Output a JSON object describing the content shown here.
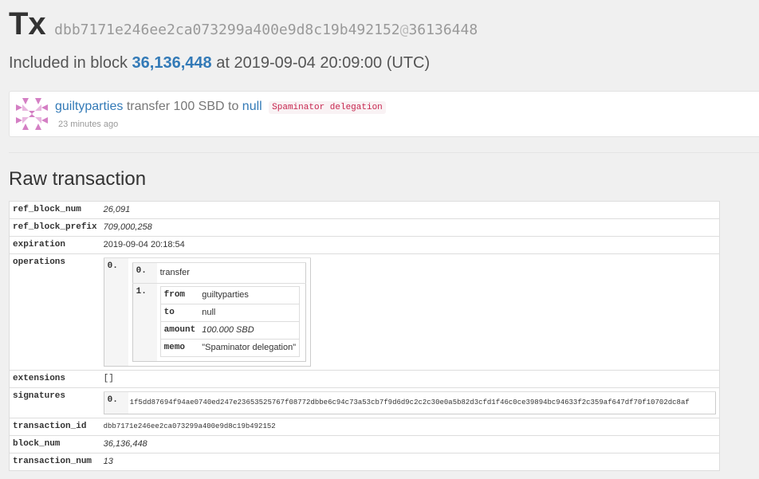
{
  "header": {
    "title": "Tx",
    "hash": "dbb7171e246ee2ca073299a400e9d8c19b492152",
    "at": "@",
    "block_ref": "36136448"
  },
  "included": {
    "prefix": "Included in block",
    "block": "36,136,448",
    "middle": "at",
    "time": "2019-09-04 20:09:00 (UTC)"
  },
  "operation": {
    "from": "guiltyparties",
    "verb": "transfer 100 SBD to",
    "to": "null",
    "memo": "Spaminator delegation",
    "ago": "23 minutes ago",
    "avatar_color": "#d47fc4"
  },
  "raw_title": "Raw transaction",
  "raw": {
    "ref_block_num": {
      "key": "ref_block_num",
      "value": "26,091"
    },
    "ref_block_prefix": {
      "key": "ref_block_prefix",
      "value": "709,000,258"
    },
    "expiration": {
      "key": "expiration",
      "value": "2019-09-04 20:18:54"
    },
    "operations": {
      "key": "operations",
      "outer_index": "0.",
      "type_index": "0.",
      "type": "transfer",
      "value_index": "1.",
      "fields": [
        {
          "key": "from",
          "value": "guiltyparties"
        },
        {
          "key": "to",
          "value": "null"
        },
        {
          "key": "amount",
          "value": "100.000 SBD"
        },
        {
          "key": "memo",
          "value": "\"Spaminator delegation\""
        }
      ]
    },
    "extensions": {
      "key": "extensions",
      "value": "[]"
    },
    "signatures": {
      "key": "signatures",
      "index": "0.",
      "value": "1f5dd87694f94ae0740ed247e23653525767f08772dbbe6c94c73a53cb7f9d6d9c2c2c30e0a5b82d3cfd1f46c0ce39894bc94633f2c359af647df70f10702dc8af"
    },
    "transaction_id": {
      "key": "transaction_id",
      "value": "dbb7171e246ee2ca073299a400e9d8c19b492152"
    },
    "block_num": {
      "key": "block_num",
      "value": "36,136,448"
    },
    "transaction_num": {
      "key": "transaction_num",
      "value": "13"
    }
  }
}
